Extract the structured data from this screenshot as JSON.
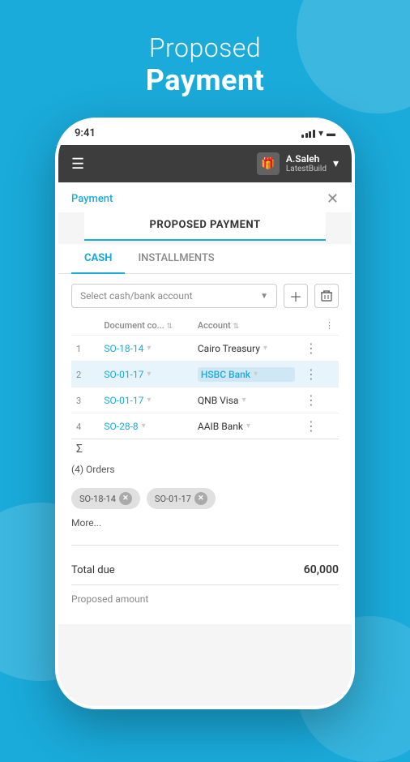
{
  "background": {
    "color": "#1AABDB"
  },
  "header": {
    "proposed": "Proposed",
    "payment": "Payment"
  },
  "status_bar": {
    "time": "9:41"
  },
  "top_nav": {
    "user_name": "A.Saleh",
    "user_sub": "LatestBuild"
  },
  "app_header": {
    "back_link": "Payment",
    "page_title": "PROPOSED PAYMENT"
  },
  "tabs": [
    {
      "label": "CASH",
      "active": true
    },
    {
      "label": "INSTALLMENTS",
      "active": false
    }
  ],
  "select_placeholder": "Select cash/bank account",
  "table": {
    "headers": {
      "num": "",
      "doc": "Document co...",
      "account": "Account",
      "more": "⋮"
    },
    "rows": [
      {
        "num": "1",
        "doc": "SO-18-14",
        "account": "Cairo Treasury",
        "highlighted": false
      },
      {
        "num": "2",
        "doc": "SO-01-17",
        "account": "HSBC Bank",
        "highlighted": true
      },
      {
        "num": "3",
        "doc": "SO-01-17",
        "account": "QNB Visa",
        "highlighted": false
      },
      {
        "num": "4",
        "doc": "SO-28-8",
        "account": "AAIB Bank",
        "highlighted": false
      }
    ]
  },
  "sigma": "Σ",
  "orders_count": "(4) Orders",
  "tags": [
    {
      "label": "SO-18-14"
    },
    {
      "label": "SO-01-17"
    }
  ],
  "more_link": "More...",
  "total": {
    "label": "Total due",
    "value": "60,000"
  },
  "proposed_label": "Proposed amount"
}
